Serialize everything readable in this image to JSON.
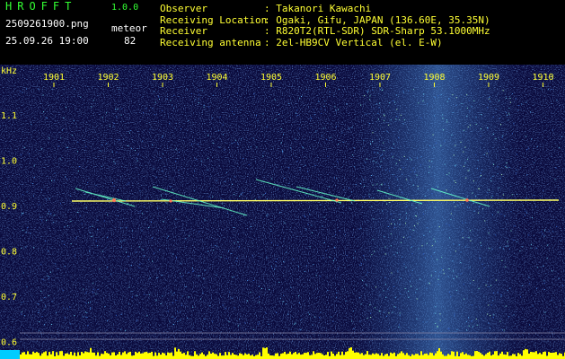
{
  "header": {
    "title": "HROFFT",
    "version": "1.0.0",
    "filename": "2509261900.png",
    "datetime": "25.09.26 19:00",
    "meteor_label": "meteor",
    "meteor_count": "82"
  },
  "info": [
    {
      "key": "Observer",
      "value": ": Takanori Kawachi"
    },
    {
      "key": "Receiving Location",
      "value": ": Ogaki, Gifu, JAPAN (136.60E, 35.35N)"
    },
    {
      "key": "Receiver",
      "value": ": R820T2(RTL-SDR) SDR-Sharp 53.1000MHz"
    },
    {
      "key": "Receiving antenna",
      "value": ": 2el-HB9CV Vertical (el. E-W)"
    }
  ],
  "axis": {
    "unit": "kHz",
    "time_ticks": [
      "1901",
      "1902",
      "1903",
      "1904",
      "1905",
      "1906",
      "1907",
      "1908",
      "1909",
      "1910"
    ],
    "freq_ticks": [
      "1.1",
      "1.0",
      "0.9",
      "0.8",
      "0.7",
      "0.6"
    ]
  },
  "colors": {
    "background": "#000000",
    "spectrogram_bg": "#0a0a3c",
    "text_yellow": "#ffff33",
    "text_white": "#ffffff",
    "title_green": "#33ff33",
    "carrier": "#ffff66",
    "meteor_trace": "#66ffcc",
    "noise_bar": "#ffff00",
    "gridline": "#8888aa"
  }
}
